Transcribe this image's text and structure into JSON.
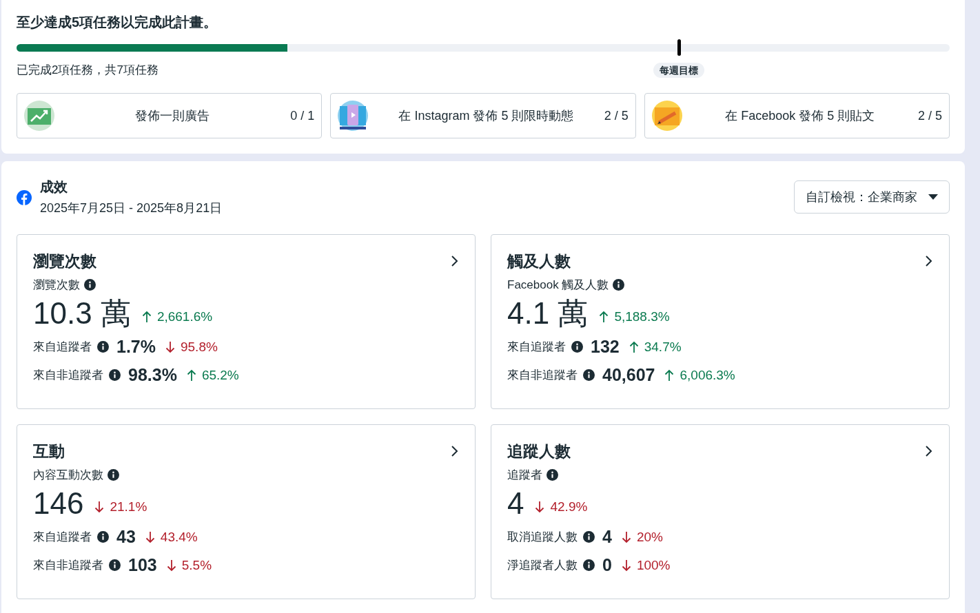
{
  "plan": {
    "title": "至少達成5項任務以完成此計畫。",
    "progress": {
      "level": 0.29
    },
    "goal": {
      "label": "每週目標",
      "level": 0.71
    },
    "summary": "已完成2項任務，共7項任務",
    "tasks": [
      {
        "kind": "chart",
        "label": "發佈一則廣告",
        "count": "0 / 1"
      },
      {
        "kind": "phone",
        "label": "在 Instagram 發佈 5 則限時動態",
        "count": "2 / 5"
      },
      {
        "kind": "pencil",
        "label": "在 Facebook 發佈 5 則貼文",
        "count": "2 / 5"
      }
    ]
  },
  "performance": {
    "title": "成效",
    "date_range": "2025年7月25日 - 2025年8月21日",
    "view_selector": "自訂檢視：企業商家",
    "metrics": [
      {
        "title": "瀏覽次數",
        "subtitle": "瀏覽次數",
        "value": "10.3 萬",
        "change": {
          "increase": true,
          "text": "2,661.6%"
        },
        "breakdown": [
          {
            "label": "來自追蹤者",
            "value": "1.7%",
            "change": {
              "increase": false,
              "text": "95.8%"
            }
          },
          {
            "label": "來自非追蹤者",
            "value": "98.3%",
            "change": {
              "increase": true,
              "text": "65.2%"
            }
          }
        ]
      },
      {
        "title": "觸及人數",
        "subtitle": "Facebook 觸及人數",
        "value": "4.1 萬",
        "change": {
          "increase": true,
          "text": "5,188.3%"
        },
        "breakdown": [
          {
            "label": "來自追蹤者",
            "value": "132",
            "change": {
              "increase": true,
              "text": "34.7%"
            }
          },
          {
            "label": "來自非追蹤者",
            "value": "40,607",
            "change": {
              "increase": true,
              "text": "6,006.3%"
            }
          }
        ]
      },
      {
        "title": "互動",
        "subtitle": "內容互動次數",
        "value": "146",
        "change": {
          "increase": false,
          "text": "21.1%"
        },
        "breakdown": [
          {
            "label": "來自追蹤者",
            "value": "43",
            "change": {
              "increase": false,
              "text": "43.4%"
            }
          },
          {
            "label": "來自非追蹤者",
            "value": "103",
            "change": {
              "increase": false,
              "text": "5.5%"
            }
          }
        ]
      },
      {
        "title": "追蹤人數",
        "subtitle": "追蹤者",
        "value": "4",
        "change": {
          "increase": false,
          "text": "42.9%"
        },
        "breakdown": [
          {
            "label": "取消追蹤人數",
            "value": "4",
            "change": {
              "increase": false,
              "text": "20%"
            }
          },
          {
            "label": "淨追蹤者人數",
            "value": "0",
            "change": {
              "increase": false,
              "text": "100%"
            }
          }
        ]
      }
    ]
  }
}
